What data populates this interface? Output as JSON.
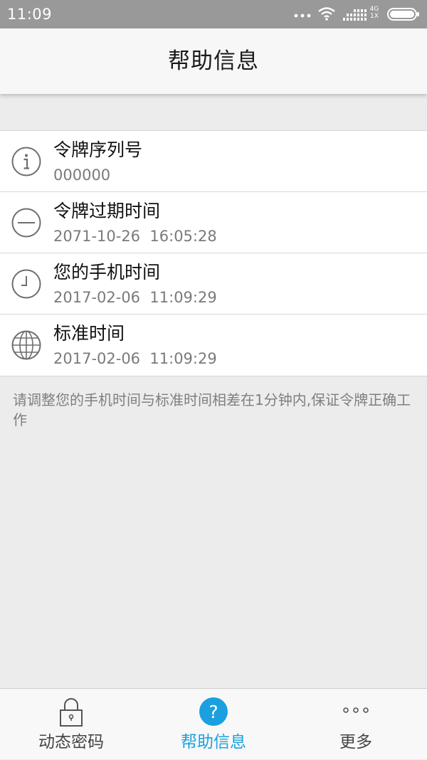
{
  "status_bar": {
    "time": "11:09",
    "network_top": "4G",
    "network_bottom": "1X"
  },
  "header": {
    "title": "帮助信息"
  },
  "info_rows": [
    {
      "icon": "info-icon",
      "title": "令牌序列号",
      "value": "000000"
    },
    {
      "icon": "minus-circle-icon",
      "title": "令牌过期时间",
      "value": "2071-10-26  16:05:28"
    },
    {
      "icon": "clock-icon",
      "title": "您的手机时间",
      "value": "2017-02-06  11:09:29"
    },
    {
      "icon": "globe-icon",
      "title": "标准时间",
      "value": "2017-02-06  11:09:29"
    }
  ],
  "notice": "请调整您的手机时间与标准时间相差在1分钟内,保证令牌正确工作",
  "bottom_nav": {
    "items": [
      {
        "icon": "lock-icon",
        "label": "动态密码",
        "active": false
      },
      {
        "icon": "help-icon",
        "label": "帮助信息",
        "active": true
      },
      {
        "icon": "more-icon",
        "label": "更多",
        "active": false
      }
    ]
  },
  "colors": {
    "accent": "#1aa0e0",
    "status_bar": "#999999",
    "background": "#ececec"
  }
}
